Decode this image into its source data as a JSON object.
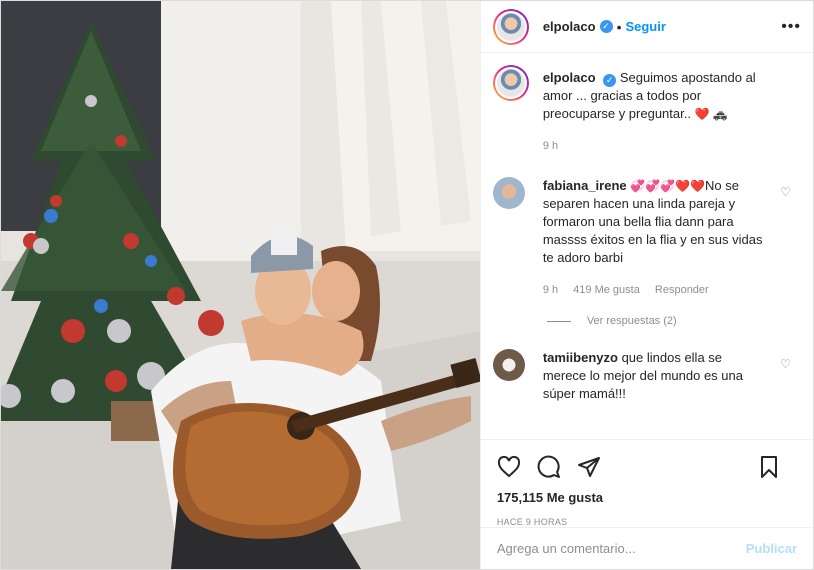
{
  "header": {
    "username": "elpolaco",
    "separator": "•",
    "follow_label": "Seguir",
    "more_label": "•••"
  },
  "caption": {
    "username": "elpolaco",
    "text": "Seguimos apostando al amor ... gracias a todos por preocuparse y preguntar..",
    "emoji": "❤️ 🚓",
    "time": "9 h"
  },
  "comments": [
    {
      "username": "fabiana_irene",
      "text": "No se separen hacen una linda pareja y formaron una bella flia dann para massss éxitos en la flia y en sus vidas te adoro barbi",
      "emoji": "💞💞💞❤️❤️",
      "time": "9 h",
      "likes": "419 Me gusta",
      "reply_label": "Responder",
      "view_replies": "Ver respuestas (2)"
    },
    {
      "username": "tamiibenyzo",
      "text": "que lindos ella se merece lo mejor del mundo es una súper mamá!!!",
      "emoji": ""
    }
  ],
  "actions": {
    "icons": [
      "heart-icon",
      "comment-icon",
      "share-icon",
      "bookmark-icon"
    ],
    "likes": "175,115 Me gusta",
    "timestamp": "Hace 9 horas"
  },
  "add_comment": {
    "placeholder": "Agrega un comentario...",
    "publish_label": "Publicar"
  },
  "colors": {
    "accent": "#0095f6",
    "verified": "#3897f0",
    "muted": "#8e8e8e",
    "publish_disabled": "#b2dffc"
  }
}
